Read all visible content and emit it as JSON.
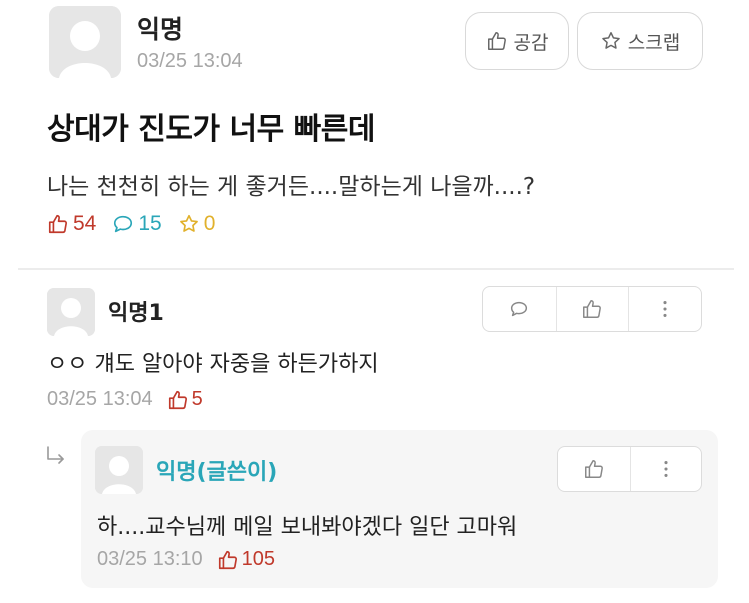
{
  "post": {
    "author": "익명",
    "time": "03/25 13:04",
    "like_button_label": "공감",
    "scrap_button_label": "스크랩",
    "title": "상대가 진도가 너무 빠른데",
    "body": "나는 천천히 하는 게 좋거든....말하는게 나을까....?",
    "stats": {
      "likes": "54",
      "comments": "15",
      "scraps": "0"
    }
  },
  "comments": [
    {
      "author": "익명1",
      "body": "ㅇㅇ 걔도 알아야 자중을 하든가하지",
      "time": "03/25 13:04",
      "likes": "5"
    }
  ],
  "reply": {
    "author": "익명(글쓴이)",
    "body": "하....교수님께 메일 보내봐야겠다 일단 고마워",
    "time": "03/25 13:10",
    "likes": "105"
  },
  "colors": {
    "like": "#c0392b",
    "comment": "#2aa6b8",
    "scrap": "#e1b12c",
    "author_op": "#2aa6b8",
    "muted": "#a6a6a6"
  },
  "icons": [
    "default-avatar-icon",
    "thumbs-up-icon",
    "star-icon",
    "speech-bubble-icon",
    "more-vertical-icon",
    "reply-arrow-icon"
  ]
}
